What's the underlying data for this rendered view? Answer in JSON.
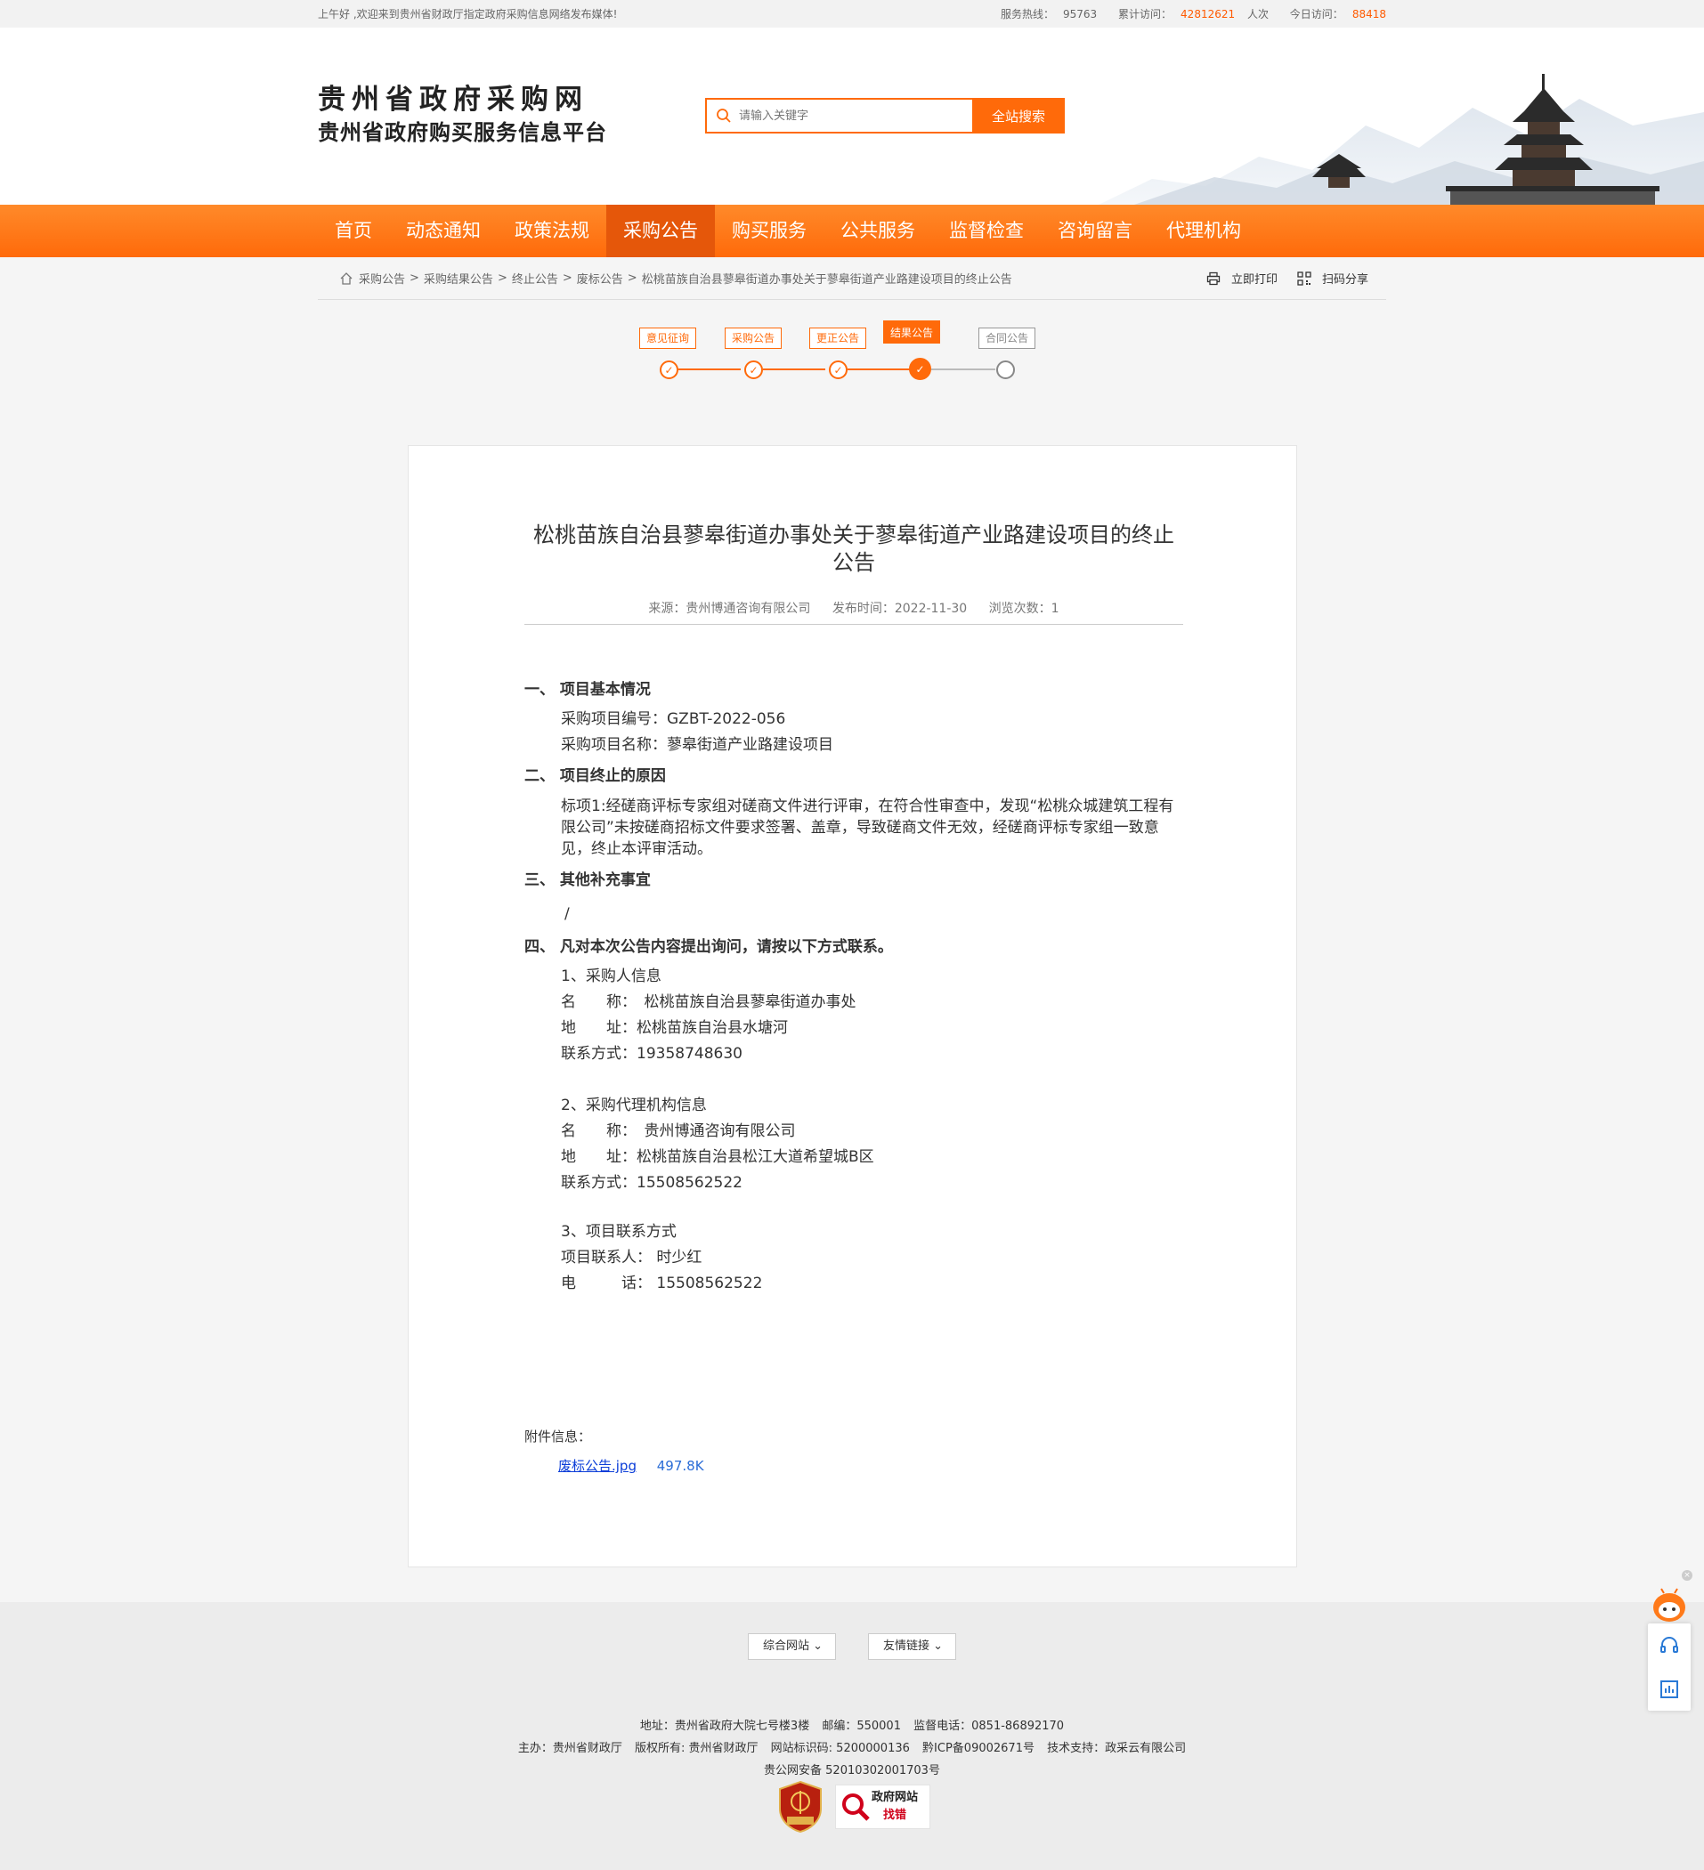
{
  "topbar": {
    "greeting": "上午好 ,欢迎来到贵州省财政厅指定政府采购信息网络发布媒体!",
    "hotline_label": "服务热线：",
    "hotline": "95763",
    "total_label": "累计访问：",
    "total": "42812621",
    "total_unit": "人次",
    "today_label": "今日访问：",
    "today": "88418"
  },
  "header": {
    "logo_line1": "贵州省政府采购网",
    "logo_line2": "贵州省政府购买服务信息平台",
    "search_placeholder": "请输入关键字",
    "search_button": "全站搜索"
  },
  "nav": {
    "items": [
      "首页",
      "动态通知",
      "政策法规",
      "采购公告",
      "购买服务",
      "公共服务",
      "监督检查",
      "咨询留言",
      "代理机构"
    ],
    "active_index": 3
  },
  "breadcrumb": {
    "items": [
      "采购公告",
      "采购结果公告",
      "终止公告",
      "废标公告",
      "松桃苗族自治县蓼皋街道办事处关于蓼皋街道产业路建设项目的终止公告"
    ],
    "separator": ">"
  },
  "tools": {
    "print": "立即打印",
    "share": "扫码分享"
  },
  "progress": {
    "steps": [
      "意见征询",
      "采购公告",
      "更正公告",
      "结果公告",
      "合同公告"
    ],
    "current_index": 3
  },
  "article": {
    "title": "松桃苗族自治县蓼皋街道办事处关于蓼皋街道产业路建设项目的终止公告",
    "source": "来源：贵州博通咨询有限公司",
    "publish": "发布时间：2022-11-30",
    "views": "浏览次数：1",
    "sections": {
      "s1_heading": "一、  项目基本情况",
      "s1_line1": "采购项目编号：GZBT-2022-056",
      "s1_line2": "采购项目名称：蓼皋街道产业路建设项目",
      "s2_heading": "二、  项目终止的原因",
      "s2_text": "标项1:经磋商评标专家组对磋商文件进行评审，在符合性审查中，发现“松桃众城建筑工程有限公司”未按磋商招标文件要求签署、盖章，导致磋商文件无效，经磋商评标专家组一致意见，终止本评审活动。",
      "s3_heading": "三、  其他补充事宜",
      "s3_text": "/",
      "s4_heading": "四、  凡对本次公告内容提出询问，请按以下方式联系。",
      "c1_title": "1、采购人信息",
      "c1_name": "名　　称：　松桃苗族自治县蓼皋街道办事处",
      "c1_addr": "地　　址：松桃苗族自治县水塘河",
      "c1_contact": "联系方式：19358748630",
      "c2_title": "2、采购代理机构信息",
      "c2_name": "名　　称：　贵州博通咨询有限公司",
      "c2_addr": "地　　址：松桃苗族自治县松江大道希望城B区",
      "c2_contact": "联系方式：15508562522",
      "c3_title": "3、项目联系方式",
      "c3_person": "项目联系人：  时少红",
      "c3_phone": "电　　　话：  15508562522"
    },
    "attachment_label": "附件信息：",
    "attachment_file": "废标公告.jpg",
    "attachment_size": "497.8K"
  },
  "footer": {
    "select1": "综合网站",
    "select2": "友情链接",
    "address": "地址：贵州省政府大院七号楼3楼",
    "postcode": "邮编：550001",
    "supervise": "监督电话：0851-86892170",
    "host": "主办：贵州省财政厅",
    "copyright": "版权所有: 贵州省财政厅",
    "site_id": "网站标识码: 5200000136",
    "icp": "黔ICP备09002671号",
    "tech": "技术支持：政采云有限公司",
    "police": "贵公网安备 52010302001703号",
    "badge_text1": "政府网站",
    "badge_text2": "找错",
    "badge_seal": "党政机关"
  },
  "colors": {
    "accent": "#ff6a0a",
    "nav_active": "#e5570a",
    "link": "#0b3dd8"
  }
}
